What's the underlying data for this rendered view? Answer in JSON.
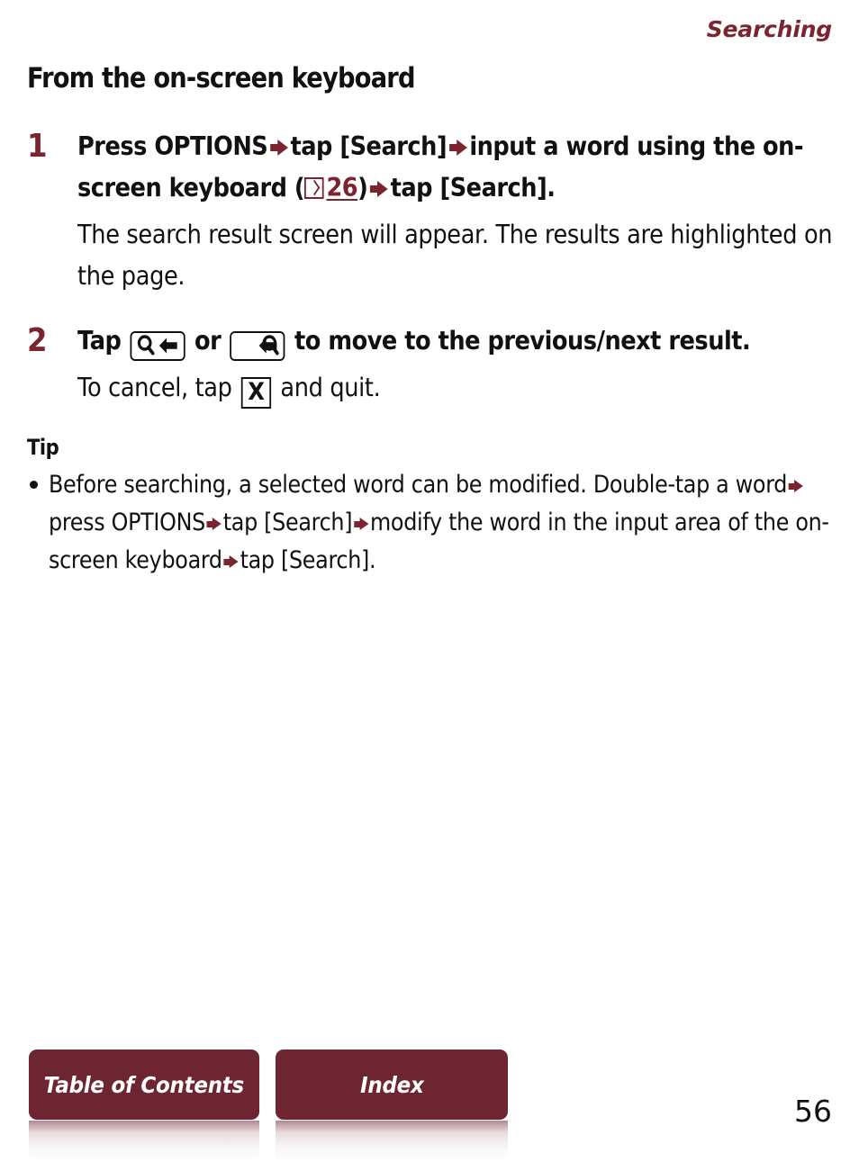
{
  "header": {
    "running_title": "Searching"
  },
  "page_title": "From the on-screen keyboard",
  "steps": [
    {
      "number": "1",
      "lead_parts": {
        "p1": "Press OPTIONS",
        "p2": "tap [Search]",
        "p3": "input a word using the on-screen keyboard (",
        "pageref_number": "26",
        "p4": ")",
        "p5": "tap [Search]."
      },
      "detail": "The search result screen will appear. The results are highlighted on the page."
    },
    {
      "number": "2",
      "lead_parts": {
        "p1": "Tap",
        "p2": "or",
        "p3": "to move to the previous/next result."
      },
      "detail_parts": {
        "p1": "To cancel, tap",
        "x_label": "X",
        "p2": "and quit."
      }
    }
  ],
  "tip": {
    "heading": "Tip",
    "bullet": {
      "p1": "Before searching, a selected word can be modified. Double-tap a word",
      "p2": "press OPTIONS",
      "p3": "tap [Search]",
      "p4": "modify the word in the input area of the on-screen keyboard",
      "p5": "tap [Search]."
    }
  },
  "bottom_nav": {
    "table_of_contents": "Table of Contents",
    "index": "Index"
  },
  "page_number": "56",
  "colors": {
    "accent_maroon": "#7B2430",
    "button_maroon": "#6E2532",
    "text_black": "#111111",
    "page_background": "#ffffff"
  }
}
